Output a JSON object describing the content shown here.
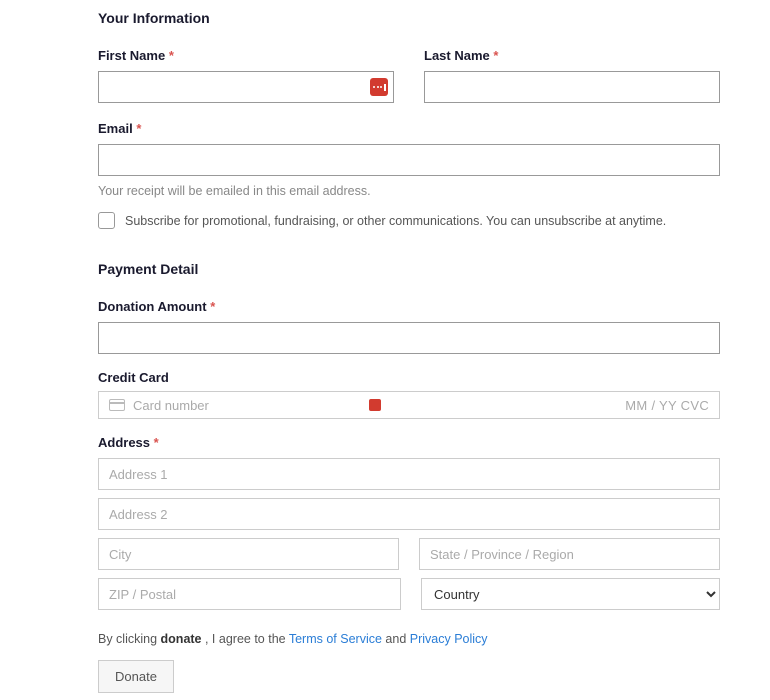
{
  "sections": {
    "info_title": "Your Information",
    "payment_title": "Payment Detail"
  },
  "labels": {
    "first_name": "First Name",
    "last_name": "Last Name",
    "email": "Email",
    "donation_amount": "Donation Amount",
    "credit_card": "Credit Card",
    "address": "Address",
    "required": "*"
  },
  "hints": {
    "email": "Your receipt will be emailed in this email address.",
    "subscribe": "Subscribe for promotional, fundraising, or other communications. You can unsubscribe at anytime."
  },
  "placeholders": {
    "card_number": "Card number",
    "card_expiry_cvc": "MM / YY  CVC",
    "address1": "Address 1",
    "address2": "Address 2",
    "city": "City",
    "state": "State / Province / Region",
    "zip": "ZIP / Postal",
    "country": "Country"
  },
  "agreement": {
    "prefix": "By clicking ",
    "action": "donate",
    "middle": " , I agree to the ",
    "terms": "Terms of Service",
    "and": " and ",
    "privacy": "Privacy Policy"
  },
  "buttons": {
    "donate": "Donate"
  },
  "values": {
    "first_name": "",
    "last_name": "",
    "email": "",
    "donation_amount": "",
    "address1": "",
    "address2": "",
    "city": "",
    "state": "",
    "zip": "",
    "subscribe": false
  }
}
